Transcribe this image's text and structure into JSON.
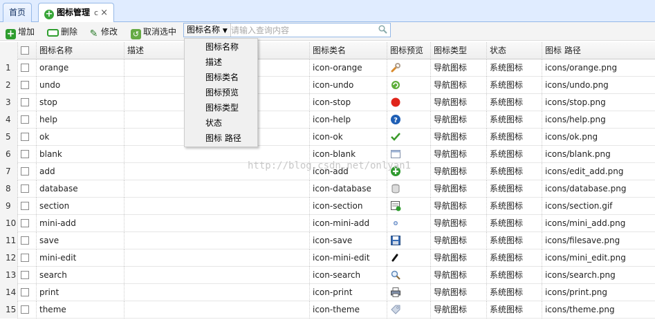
{
  "tabs": [
    {
      "label": "首页"
    },
    {
      "label": "图标管理",
      "reload": "c",
      "close": "×"
    }
  ],
  "toolbar": {
    "add": "增加",
    "delete": "删除",
    "edit": "修改",
    "unselect": "取消选中",
    "search_field": "图标名称",
    "search_placeholder": "请输入查询内容"
  },
  "columns": [
    "图标名称",
    "描述",
    "图标类名",
    "图标预览",
    "图标类型",
    "状态",
    "图标 路径"
  ],
  "dropdown": [
    "图标名称",
    "描述",
    "图标类名",
    "图标预览",
    "图标类型",
    "状态",
    "图标 路径"
  ],
  "rows": [
    {
      "n": "1",
      "name": "orange",
      "desc": "",
      "cls": "icon-orange",
      "icon": "wrench-icon",
      "type": "导航图标",
      "status": "系统图标",
      "path": "icons/orange.png"
    },
    {
      "n": "2",
      "name": "undo",
      "desc": "",
      "cls": "icon-undo",
      "icon": "undo-icon",
      "type": "导航图标",
      "status": "系统图标",
      "path": "icons/undo.png"
    },
    {
      "n": "3",
      "name": "stop",
      "desc": "",
      "cls": "icon-stop",
      "icon": "stop-icon",
      "type": "导航图标",
      "status": "系统图标",
      "path": "icons/stop.png"
    },
    {
      "n": "4",
      "name": "help",
      "desc": "",
      "cls": "icon-help",
      "icon": "help-icon",
      "type": "导航图标",
      "status": "系统图标",
      "path": "icons/help.png"
    },
    {
      "n": "5",
      "name": "ok",
      "desc": "",
      "cls": "icon-ok",
      "icon": "check-icon",
      "type": "导航图标",
      "status": "系统图标",
      "path": "icons/ok.png"
    },
    {
      "n": "6",
      "name": "blank",
      "desc": "",
      "cls": "icon-blank",
      "icon": "blank-icon",
      "type": "导航图标",
      "status": "系统图标",
      "path": "icons/blank.png"
    },
    {
      "n": "7",
      "name": "add",
      "desc": "",
      "cls": "icon-add",
      "icon": "add-icon",
      "type": "导航图标",
      "status": "系统图标",
      "path": "icons/edit_add.png"
    },
    {
      "n": "8",
      "name": "database",
      "desc": "",
      "cls": "icon-database",
      "icon": "database-icon",
      "type": "导航图标",
      "status": "系统图标",
      "path": "icons/database.png"
    },
    {
      "n": "9",
      "name": "section",
      "desc": "",
      "cls": "icon-section",
      "icon": "section-icon",
      "type": "导航图标",
      "status": "系统图标",
      "path": "icons/section.gif"
    },
    {
      "n": "10",
      "name": "mini-add",
      "desc": "",
      "cls": "icon-mini-add",
      "icon": "mini-add-icon",
      "type": "导航图标",
      "status": "系统图标",
      "path": "icons/mini_add.png"
    },
    {
      "n": "11",
      "name": "save",
      "desc": "",
      "cls": "icon-save",
      "icon": "save-icon",
      "type": "导航图标",
      "status": "系统图标",
      "path": "icons/filesave.png"
    },
    {
      "n": "12",
      "name": "mini-edit",
      "desc": "",
      "cls": "icon-mini-edit",
      "icon": "mini-edit-icon",
      "type": "导航图标",
      "status": "系统图标",
      "path": "icons/mini_edit.png"
    },
    {
      "n": "13",
      "name": "search",
      "desc": "",
      "cls": "icon-search",
      "icon": "search-icon",
      "type": "导航图标",
      "status": "系统图标",
      "path": "icons/search.png"
    },
    {
      "n": "14",
      "name": "print",
      "desc": "",
      "cls": "icon-print",
      "icon": "print-icon",
      "type": "导航图标",
      "status": "系统图标",
      "path": "icons/print.png"
    },
    {
      "n": "15",
      "name": "theme",
      "desc": "",
      "cls": "icon-theme",
      "icon": "theme-icon",
      "type": "导航图标",
      "status": "系统图标",
      "path": "icons/theme.png"
    }
  ],
  "watermark": "http://blog.csdn.net/onlyan1"
}
